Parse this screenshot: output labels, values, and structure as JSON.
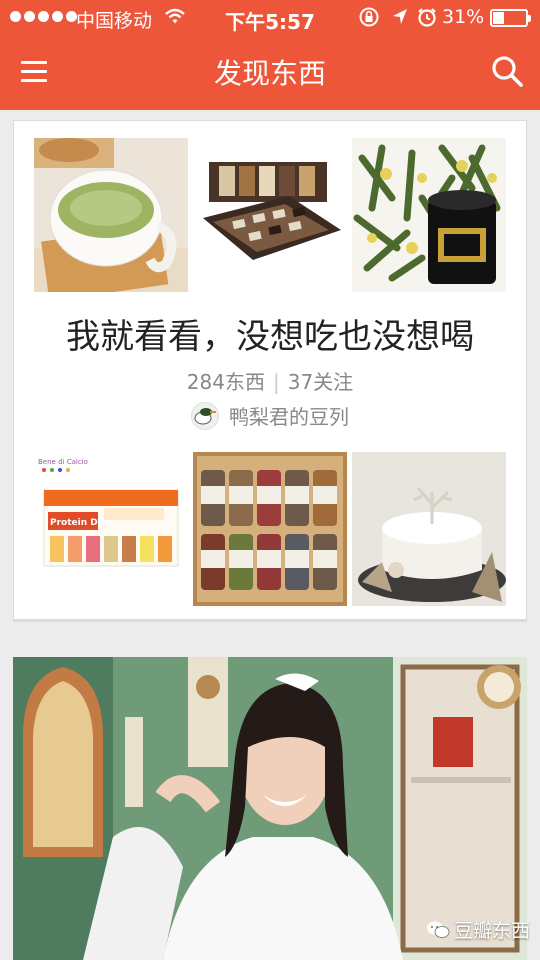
{
  "status_bar": {
    "carrier": "中国移动",
    "time": "下午5:57",
    "battery_percent": "31%",
    "battery_level": 0.31
  },
  "nav": {
    "title": "发现东西",
    "menu_icon": "hamburger-menu-icon",
    "search_icon": "search-icon"
  },
  "collection": {
    "title": "我就看看，没想吃也没想喝",
    "item_count": "284东西",
    "followers": "37关注",
    "author": "鸭梨君的豆列",
    "thumbnails": [
      "matcha-latte",
      "chocolate-gift-box",
      "green-tea-tin",
      "protein-diet-box",
      "spice-jar-set",
      "white-cake"
    ],
    "thumb_texts": {
      "protein_diet": "Protein Diet",
      "brand": "Bene di Calcio"
    }
  },
  "colors": {
    "brand": "#ee5639",
    "background": "#ececec",
    "card": "#ffffff",
    "text_primary": "#222222",
    "text_secondary": "#888888"
  },
  "watermark": {
    "text": "豆瓣东西",
    "icon": "wechat-icon"
  }
}
